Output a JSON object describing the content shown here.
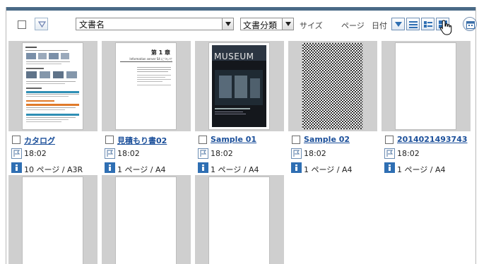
{
  "toolbar": {
    "docname_label": "文書名",
    "category_label": "文書分類",
    "size_label": "サイズ",
    "page_label": "ページ",
    "date_label": "日付"
  },
  "cards": [
    {
      "title": "カタログ",
      "time": "18:02",
      "pages": "10 ページ / A3R",
      "thumb": "catalog-page"
    },
    {
      "title": "見積もり書02",
      "time": "18:02",
      "pages": "1 ページ / A4",
      "thumb": "estimate-page"
    },
    {
      "title": "Sample 01",
      "time": "18:02",
      "pages": "1 ページ / A4",
      "thumb": "museum-poster"
    },
    {
      "title": "Sample 02",
      "time": "18:02",
      "pages": "1 ページ / A4",
      "thumb": "checker-pattern"
    },
    {
      "title": "2014021493743",
      "time": "18:02",
      "pages": "1 ページ / A4",
      "thumb": "blank-page"
    },
    {
      "thumb": "blank-page"
    },
    {
      "thumb": "blank-page"
    },
    {
      "thumb": "blank-page"
    }
  ],
  "thumb_text": {
    "estimate_heading": "第 1 章",
    "estimate_sub": "Information server S4 について",
    "museum_word": "MUSEUM"
  },
  "icons": {
    "sort": "sort-down-icon",
    "dropdown": "chevron-down-icon",
    "view_detail": "list-view-icon",
    "view_compact": "compact-list-icon",
    "view_thumbnail": "thumbnail-view-icon",
    "calendar": "calendar-icon",
    "flag": "flag-icon",
    "info": "info-icon",
    "cursor": "hand-cursor-icon"
  },
  "colors": {
    "topbar": "#4a6a86",
    "title_link": "#1b4f9a",
    "thumb_bg": "#cfcfcf",
    "icon_blue": "#2f6fb3"
  }
}
